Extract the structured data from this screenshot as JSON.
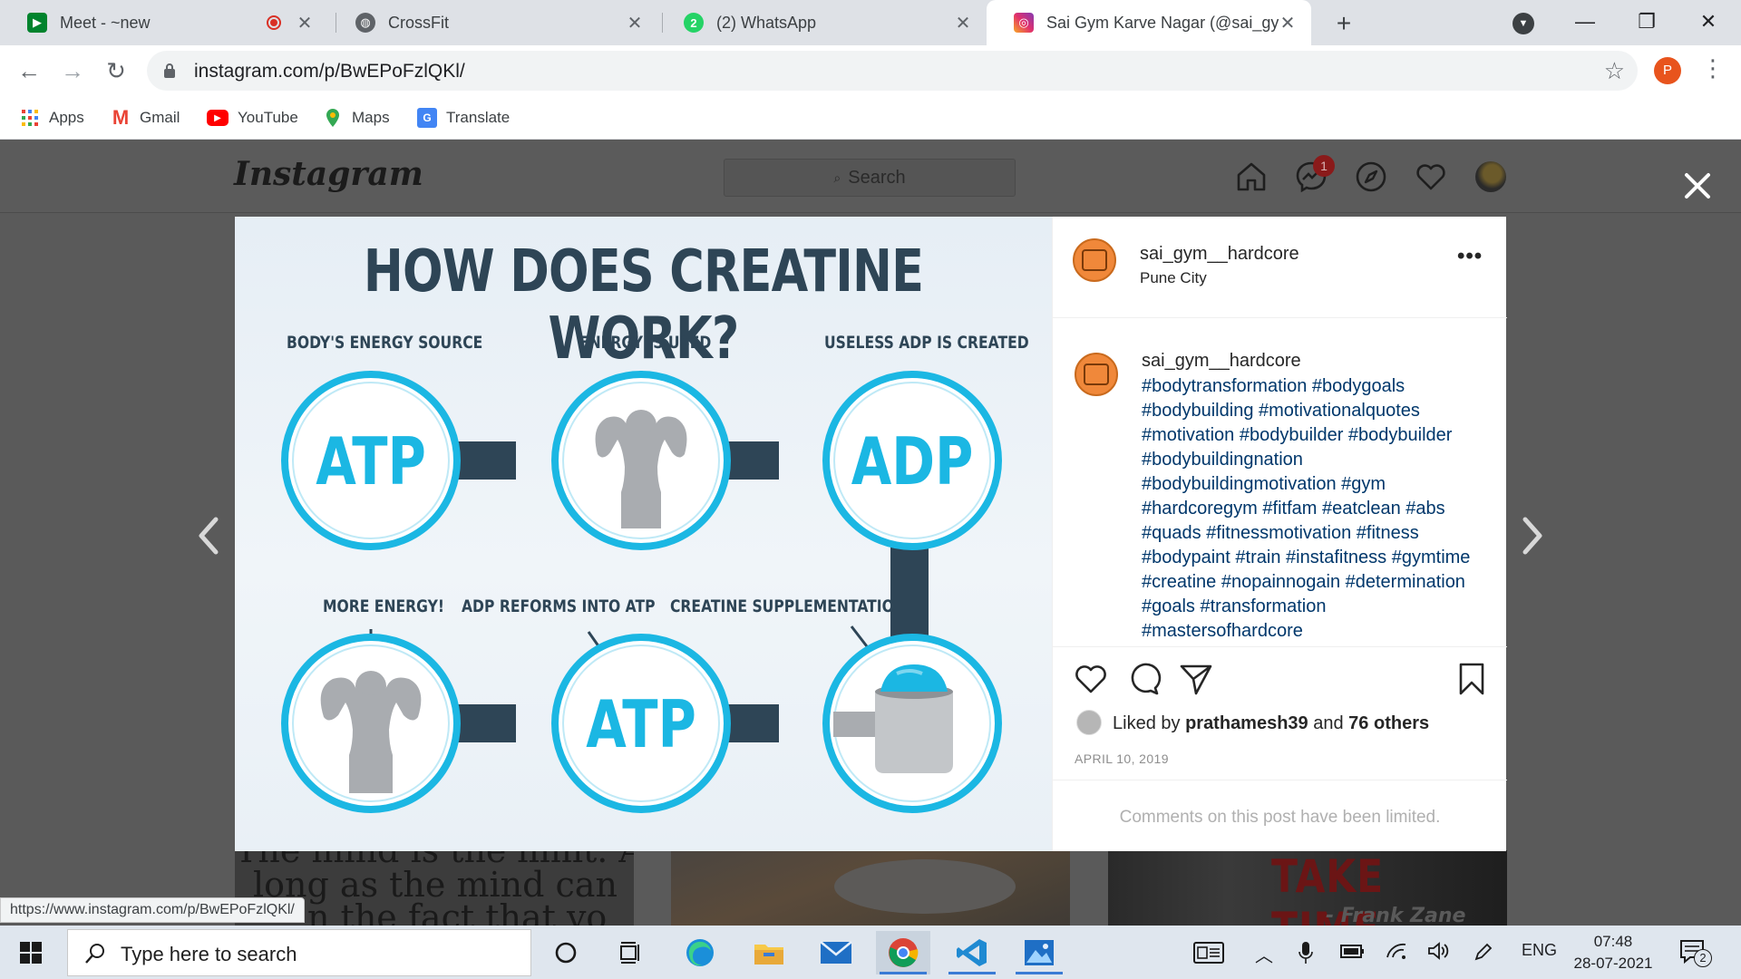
{
  "browser": {
    "tabs": [
      {
        "title": "Meet - ~new",
        "icon": "google-meet-icon",
        "recording": true
      },
      {
        "title": "CrossFit",
        "icon": "globe-icon",
        "recording": false
      },
      {
        "title": "(2) WhatsApp",
        "icon": "whatsapp-icon",
        "badge": "2",
        "recording": false
      },
      {
        "title": "Sai Gym Karve Nagar (@sai_gym_",
        "icon": "instagram-icon",
        "active": true
      }
    ],
    "new_tab_label": "+",
    "url": "instagram.com/p/BwEPoFzlQKl/",
    "profile_initial": "P",
    "bookmarks": [
      {
        "label": "Apps",
        "icon": "apps-grid-icon"
      },
      {
        "label": "Gmail",
        "icon": "gmail-icon"
      },
      {
        "label": "YouTube",
        "icon": "youtube-icon"
      },
      {
        "label": "Maps",
        "icon": "maps-pin-icon"
      },
      {
        "label": "Translate",
        "icon": "translate-icon"
      }
    ],
    "status_link": "https://www.instagram.com/p/BwEPoFzlQKl/"
  },
  "instagram": {
    "logo": "Instagram",
    "search_placeholder": "Search",
    "messages_badge": "1",
    "post": {
      "username": "sai_gym__hardcore",
      "location": "Pune City",
      "more": "•••",
      "caption_user": "sai_gym__hardcore",
      "caption_tags": "#bodytransformation #bodygoals #bodybuilding #motivationalquotes #motivation #bodybuilder #bodybuilder #bodybuildingnation #bodybuildingmotivation #gym #hardcoregym #fitfam #eatclean #abs #quads #fitnessmotivation #fitness #bodypaint #train #instafitness #gymtime #creatine #nopainnogain #determination #goals #transformation #mastersofhardcore",
      "likes_prefix": "Liked by ",
      "likes_user": "prathamesh39",
      "likes_and": " and ",
      "likes_others": "76 others",
      "date": "APRIL 10, 2019",
      "comments_limited": "Comments on this post have been limited."
    },
    "infographic": {
      "title": "HOW DOES CREATINE WORK?",
      "label_1": "BODY'S ENERGY SOURCE",
      "label_2": "ENERGY IS USED",
      "label_3": "USELESS ADP IS CREATED",
      "label_4": "MORE ENERGY!",
      "label_5": "ADP REFORMS INTO ATP",
      "label_6": "CREATINE SUPPLEMENTATION",
      "circle_1": "ATP",
      "circle_3": "ADP",
      "circle_5": "ATP"
    },
    "thumbs": {
      "thumb_1_line1": "The mind is the limit. A",
      "thumb_1_line2": "long as the mind can",
      "thumb_1_line3": "n the fact that yo",
      "thumb_3_title": "TAKE TIME",
      "thumb_3_author": "- Frank Zane"
    }
  },
  "taskbar": {
    "search_placeholder": "Type here to search",
    "language": "ENG",
    "time": "07:48",
    "date": "28-07-2021",
    "notifications": "2"
  },
  "colors": {
    "accent_cyan": "#1bb7e3",
    "infographic_dark": "#2e4556",
    "link_blue": "#00376b"
  }
}
